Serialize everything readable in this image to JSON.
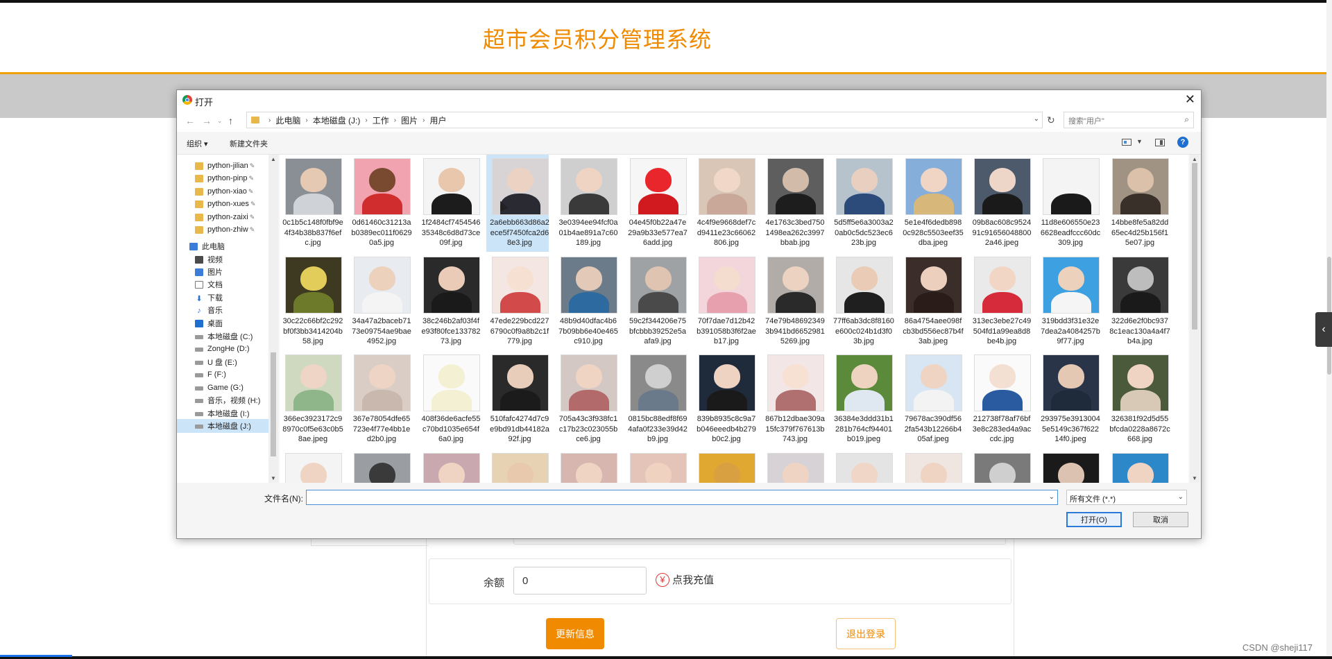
{
  "site": {
    "title": "超市会员积分管理系统",
    "balance_label": "余额",
    "balance_value": "0",
    "recharge_label": "点我充值",
    "recharge_icon": "yen-circle-icon",
    "update_button": "更新信息",
    "logout_button": "退出登录",
    "watermark": "CSDN @sheji117",
    "accent_color": "#f08a00"
  },
  "dialog": {
    "title": "打开",
    "breadcrumb": [
      "此电脑",
      "本地磁盘 (J:)",
      "工作",
      "图片",
      "用户"
    ],
    "search_placeholder": "搜索\"用户\"",
    "toolbar": {
      "organize": "组织 ▾",
      "new_folder": "新建文件夹"
    },
    "sidebar": [
      {
        "label": "python-jilian",
        "icon": "folder-icon",
        "pinned": true
      },
      {
        "label": "python-pinp",
        "icon": "folder-icon",
        "pinned": true
      },
      {
        "label": "python-xiao",
        "icon": "folder-icon",
        "pinned": true
      },
      {
        "label": "python-xues",
        "icon": "folder-icon",
        "pinned": true
      },
      {
        "label": "python-zaixi",
        "icon": "folder-icon",
        "pinned": true
      },
      {
        "label": "python-zhiw",
        "icon": "folder-icon",
        "pinned": true
      },
      {
        "label": "此电脑",
        "icon": "pc-icon",
        "pinned": false
      },
      {
        "label": "视频",
        "icon": "video-icon",
        "pinned": false
      },
      {
        "label": "图片",
        "icon": "pics-icon",
        "pinned": false
      },
      {
        "label": "文档",
        "icon": "doc-icon",
        "pinned": false
      },
      {
        "label": "下载",
        "icon": "dl-icon",
        "pinned": false
      },
      {
        "label": "音乐",
        "icon": "music-icon",
        "pinned": false
      },
      {
        "label": "桌面",
        "icon": "desk-icon",
        "pinned": false
      },
      {
        "label": "本地磁盘 (C:)",
        "icon": "drive-icon",
        "pinned": false
      },
      {
        "label": "ZongHe (D:)",
        "icon": "drive-icon",
        "pinned": false
      },
      {
        "label": "U 盘 (E:)",
        "icon": "drive-icon",
        "pinned": false
      },
      {
        "label": "F (F:)",
        "icon": "drive-icon",
        "pinned": false
      },
      {
        "label": "Game (G:)",
        "icon": "drive-icon",
        "pinned": false
      },
      {
        "label": "音乐，视频 (H:)",
        "icon": "drive-icon",
        "pinned": false
      },
      {
        "label": "本地磁盘 (I:)",
        "icon": "drive-icon",
        "pinned": false
      },
      {
        "label": "本地磁盘 (J:)",
        "icon": "drive-icon",
        "pinned": false,
        "selected": true
      }
    ],
    "files": [
      {
        "name": "0c1b5c148f0fbf9e4f34b38b837f6efc.jpg",
        "bg": "#8a8f96",
        "skin": "#e6c9b3",
        "cloth": "#cfd3d8"
      },
      {
        "name": "0d61460c31213ab0389ec011f06290a5.jpg",
        "bg": "#f2a3b0",
        "skin": "#7a4a30",
        "cloth": "#d02e2e"
      },
      {
        "name": "1f2484cf745454635348c6d8d73ce09f.jpg",
        "bg": "#f4f4f4",
        "skin": "#e9c7ad",
        "cloth": "#1c1c1c"
      },
      {
        "name": "2a6ebb663d86a2ece5f7450fca2d68e3.jpg",
        "bg": "#d8d4d6",
        "skin": "#ecd2c3",
        "cloth": "#2a2a33",
        "selected": true
      },
      {
        "name": "3e0394ee94fcf0a01b4ae891a7c60189.jpg",
        "bg": "#cfcfcf",
        "skin": "#efd3c3",
        "cloth": "#3a3a3a"
      },
      {
        "name": "04e45f0b22a47e29a9b33e577ea76add.jpg",
        "bg": "#f6f6f6",
        "skin": "#e8262b",
        "cloth": "#d11a1f"
      },
      {
        "name": "4c4f9e9668def7cd9411e23c66062806.jpg",
        "bg": "#d9c6b7",
        "skin": "#f0d7c7",
        "cloth": "#c9a89a"
      },
      {
        "name": "4e1763c3bed7501498ea262c3997bbab.jpg",
        "bg": "#5e5e5e",
        "skin": "#d3bba9",
        "cloth": "#1d1d1d"
      },
      {
        "name": "5d5ff5e6a3003a20ab0c5dc523ec623b.jpg",
        "bg": "#b6c3cc",
        "skin": "#e8cfbf",
        "cloth": "#2c4a7a"
      },
      {
        "name": "5e1e4f6dedb8980c928c5503eef35dba.jpeg",
        "bg": "#86aedb",
        "skin": "#f0d5c4",
        "cloth": "#d8b77a"
      },
      {
        "name": "09b8ac608c952491c916560488002a46.jpeg",
        "bg": "#4c5a6b",
        "skin": "#edd5c7",
        "cloth": "#1a1a1a"
      },
      {
        "name": "11d8e606550e236628eadfccc60dc309.jpg",
        "bg": "#f4f4f4",
        "skin": "#f4f4f4",
        "cloth": "#1a1a1a"
      },
      {
        "name": "14bbe8fe5a82dd65ec4d25b156f15e07.jpg",
        "bg": "#a09383",
        "skin": "#dcc1aa",
        "cloth": "#3a302a"
      },
      {
        "name": "30c22c66bf2c292bf0f3bb3414204b58.jpg",
        "bg": "#3e3a22",
        "skin": "#e2cc5a",
        "cloth": "#6c7a2a"
      },
      {
        "name": "34a47a2baceb7173e09754ae9bae4952.jpg",
        "bg": "#e8ecf0",
        "skin": "#ecd1bd",
        "cloth": "#f4f4f4"
      },
      {
        "name": "38c246b2af03f4fe93f80fce13378273.jpg",
        "bg": "#2a2a2a",
        "skin": "#e9cbb8",
        "cloth": "#1a1a1a"
      },
      {
        "name": "47ede229bcd2276790c0f9a8b2c1f779.jpg",
        "bg": "#f4e6e3",
        "skin": "#f6e0d2",
        "cloth": "#d24a4a"
      },
      {
        "name": "48b9d40dfac4b67b09bb6e40e465c910.jpg",
        "bg": "#6b7b89",
        "skin": "#e3c9b7",
        "cloth": "#2c6aa0"
      },
      {
        "name": "59c2f344206e75bfcbbb39252e5aafa9.jpg",
        "bg": "#9ea2a4",
        "skin": "#dec4b1",
        "cloth": "#4a4a4a"
      },
      {
        "name": "70f7dae7d12b42b391058b3f6f2aeb17.jpg",
        "bg": "#f3d6db",
        "skin": "#f4dccf",
        "cloth": "#e7a0ae"
      },
      {
        "name": "74e79b486923493b941bd66529815269.jpg",
        "bg": "#b1aca7",
        "skin": "#ecd2c1",
        "cloth": "#2a2a2a"
      },
      {
        "name": "77ff6ab3dc8f8160e600c024b1d3f03b.jpg",
        "bg": "#e6e6e6",
        "skin": "#e9cbb6",
        "cloth": "#1f1f1f"
      },
      {
        "name": "86a4754aee098fcb3bd556ec87b4f3ab.jpeg",
        "bg": "#3b2e2a",
        "skin": "#ecd0bd",
        "cloth": "#2a1d19"
      },
      {
        "name": "313ec3ebe27c49504fd1a99ea8d8be4b.jpg",
        "bg": "#eaeaea",
        "skin": "#f1d6c6",
        "cloth": "#d52b3b"
      },
      {
        "name": "319bdd3f31e32e7dea2a4084257b9f77.jpg",
        "bg": "#3da0e0",
        "skin": "#ecd1bd",
        "cloth": "#f5f5f5"
      },
      {
        "name": "322d6e2f0bc9378c1eac130a4a4f7b4a.jpg",
        "bg": "#3a3a3a",
        "skin": "#bdbdbd",
        "cloth": "#1a1a1a"
      },
      {
        "name": "366ec3923172c98970c0f5e63c0b58ae.jpeg",
        "bg": "#cfd9bf",
        "skin": "#efd5c5",
        "cloth": "#8fb58a"
      },
      {
        "name": "367e78054dfe65723e4f77e4bb1ed2b0.jpg",
        "bg": "#d9cdc6",
        "skin": "#eed4c4",
        "cloth": "#c8b8ad"
      },
      {
        "name": "408f36de6acfe55c70bd1035e654f6a0.jpg",
        "bg": "#fafafa",
        "skin": "#f4f0d4",
        "cloth": "#f4f0d4"
      },
      {
        "name": "510fafc4274d7c9e9bd91db44182a92f.jpg",
        "bg": "#2a2a2a",
        "skin": "#e9cdbb",
        "cloth": "#1b1b1b"
      },
      {
        "name": "705a43c3f938fc1c17b23c023055bce6.jpg",
        "bg": "#d4c8c4",
        "skin": "#efd4c4",
        "cloth": "#b26a6a"
      },
      {
        "name": "0815bc88edf8f694afa0f233e39d42b9.jpg",
        "bg": "#8a8a8a",
        "skin": "#cfcfcf",
        "cloth": "#6b7a8a"
      },
      {
        "name": "839b8935c8c9a7b046eeedb4b279b0c2.jpg",
        "bg": "#1f2a3a",
        "skin": "#efd3c2",
        "cloth": "#1a1a1a"
      },
      {
        "name": "867b12dbae309a15fc379f767613b743.jpg",
        "bg": "#f3e6e6",
        "skin": "#f6e1d3",
        "cloth": "#b07070"
      },
      {
        "name": "36384e3ddd31b1281b764cf94401b019.jpeg",
        "bg": "#5a8a3a",
        "skin": "#eed3c1",
        "cloth": "#dfe8f0"
      },
      {
        "name": "79678ac390df562fa543b12266b405af.jpeg",
        "bg": "#d7e6f2",
        "skin": "#efd4c3",
        "cloth": "#f3f3f3"
      },
      {
        "name": "212738f78af76bf3e8c283ed4a9accdc.jpg",
        "bg": "#fafafa",
        "skin": "#f4e0d2",
        "cloth": "#2a5aa0"
      },
      {
        "name": "293975e39130045e5149c367f62214f0.jpeg",
        "bg": "#2a3448",
        "skin": "#e4c8b4",
        "cloth": "#1f2a3a"
      },
      {
        "name": "326381f92d5d55bfcda0228a8672c668.jpg",
        "bg": "#4a5a3a",
        "skin": "#efd4c3",
        "cloth": "#d8c8b6"
      },
      {
        "name": "",
        "bg": "#f4f4f4",
        "skin": "#efd4c3",
        "cloth": "#f4f4f4"
      },
      {
        "name": "",
        "bg": "#9a9ea2",
        "skin": "#3a3a3a",
        "cloth": "#2a2a2a"
      },
      {
        "name": "",
        "bg": "#c9a8b0",
        "skin": "#efd4c3",
        "cloth": "#8a3a4a"
      },
      {
        "name": "",
        "bg": "#e8d2b4",
        "skin": "#e9c9ad",
        "cloth": "#2a2a2a"
      },
      {
        "name": "",
        "bg": "#d8b6b0",
        "skin": "#efd4c3",
        "cloth": "#b07a70"
      },
      {
        "name": "",
        "bg": "#e4c3b8",
        "skin": "#efd2c0",
        "cloth": "#7a4a3a"
      },
      {
        "name": "",
        "bg": "#e0a830",
        "skin": "#d8a040",
        "cloth": "#c89030"
      },
      {
        "name": "",
        "bg": "#d6d2d6",
        "skin": "#efd4c3",
        "cloth": "#c8b8c8"
      },
      {
        "name": "",
        "bg": "#e4e4e4",
        "skin": "#efd6c6",
        "cloth": "#d4c0b0"
      },
      {
        "name": "",
        "bg": "#efe6e2",
        "skin": "#efd4c3",
        "cloth": "#e4d4cc"
      },
      {
        "name": "",
        "bg": "#7a7a7a",
        "skin": "#cfcfcf",
        "cloth": "#3a3a3a"
      },
      {
        "name": "",
        "bg": "#1a1a1a",
        "skin": "#dcc2b0",
        "cloth": "#2a2a2a"
      },
      {
        "name": "",
        "bg": "#2c88c8",
        "skin": "#efd4c3",
        "cloth": "#f0f0f0"
      }
    ],
    "filename_label": "文件名(N):",
    "filename_value": "",
    "filter": "所有文件 (*.*)",
    "open_button": "打开(O)",
    "cancel_button": "取消"
  }
}
